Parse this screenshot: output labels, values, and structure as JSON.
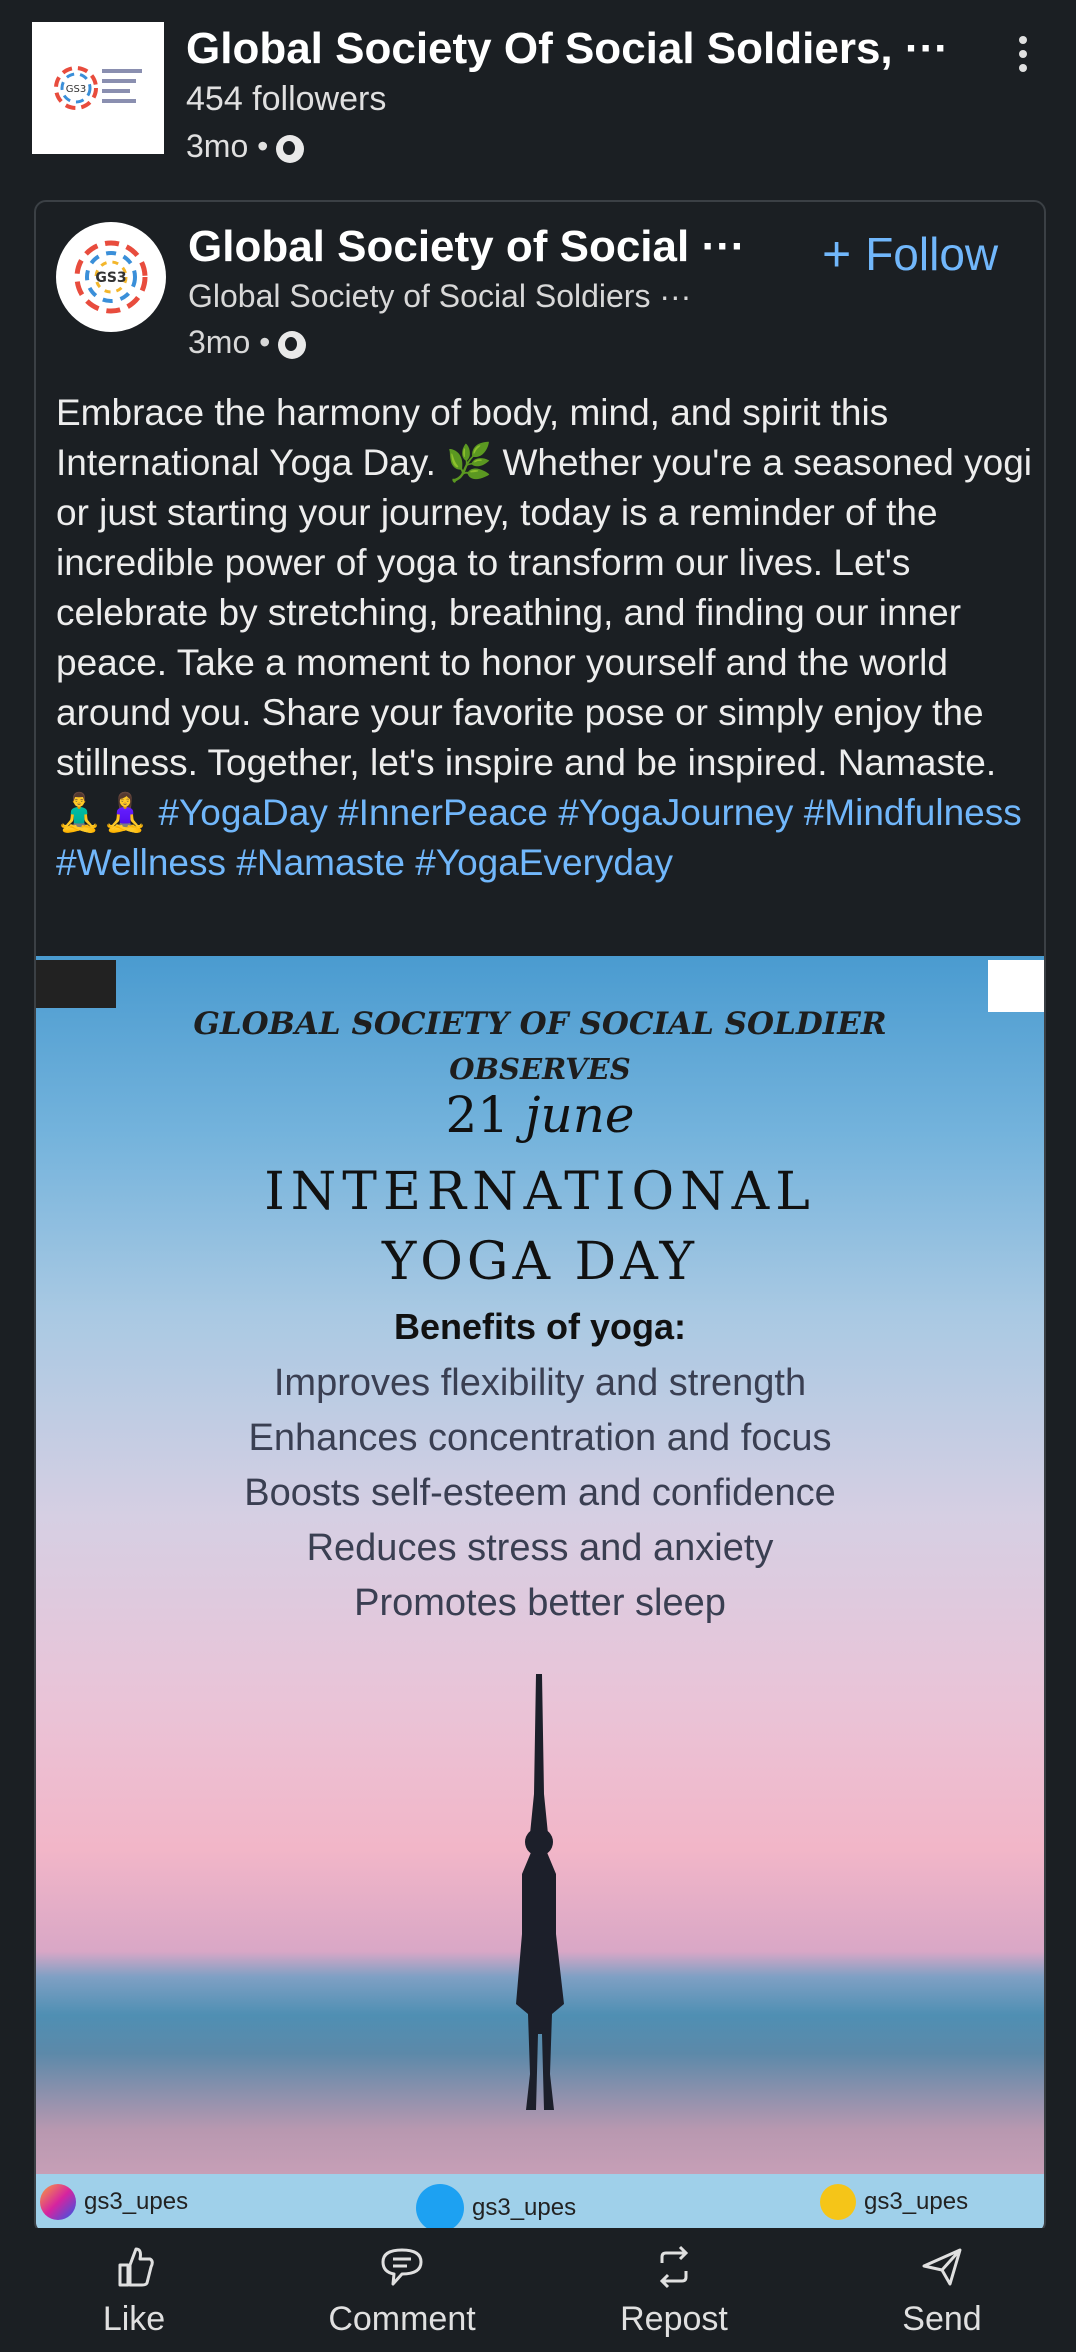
{
  "header": {
    "title": "Global Society Of Social Soldiers, ···",
    "followers": "454 followers",
    "time": "3mo •",
    "logo_text": "GS3 GLOBAL SOCIETY OF SOCIAL SOLDIERS"
  },
  "card": {
    "title": "Global Society of Social ···",
    "subtitle": "Global Society of Social Soldiers ···",
    "time": "3mo •",
    "follow_label": "Follow",
    "post_text": "Embrace the harmony of body, mind, and spirit this International Yoga Day. 🌿 Whether you're a seasoned yogi or just starting your journey, today is a reminder of the incredible power of yoga to transform our lives. Let's celebrate by stretching, breathing, and finding our inner peace. Take a moment to honor yourself and the world around you. Share your favorite pose or simply enjoy the stillness. Together, let's inspire and be inspired. Namaste. 🧘‍♂️🧘‍♀️",
    "hashtags": [
      "#YogaDay",
      "#InnerPeace",
      "#YogaJourney",
      "#Mindfulness",
      "#Wellness",
      "#Namaste",
      "#YogaEveryday"
    ]
  },
  "image": {
    "line1": "GLOBAL SOCIETY OF SOCIAL SOLDIER",
    "line2": "OBSERVES",
    "date_num": "21",
    "date_month": "june",
    "intl": "INTERNATIONAL",
    "yoga": "YOGA DAY",
    "benefits_heading": "Benefits of yoga:",
    "benefits": [
      "Improves flexibility and strength",
      "Enhances concentration and focus",
      "Boosts self-esteem and confidence",
      "Reduces stress and anxiety",
      "Promotes better sleep"
    ],
    "footer": {
      "instagram": "gs3_upes",
      "twitter": "gs3_upes",
      "facebook": "gs3_upes"
    }
  },
  "actions": {
    "like": "Like",
    "comment": "Comment",
    "repost": "Repost",
    "send": "Send"
  },
  "colors": {
    "background": "#1b1f23",
    "link": "#71b7fb"
  }
}
